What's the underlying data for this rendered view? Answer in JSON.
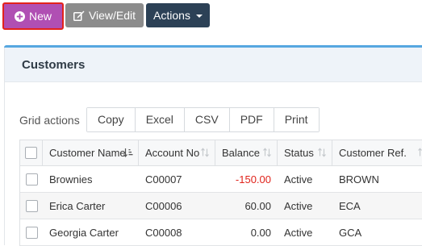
{
  "toolbar": {
    "new_label": "New",
    "view_edit_label": "View/Edit",
    "actions_label": "Actions"
  },
  "panel": {
    "title": "Customers"
  },
  "grid_actions": {
    "label": "Grid actions",
    "buttons": [
      "Copy",
      "Excel",
      "CSV",
      "PDF",
      "Print"
    ]
  },
  "table": {
    "columns": [
      "Customer Name",
      "Account No",
      "Balance",
      "Status",
      "Customer Ref."
    ],
    "rows": [
      {
        "name": "Brownies",
        "account": "C00007",
        "balance": "-150.00",
        "status": "Active",
        "ref": "BROWN"
      },
      {
        "name": "Erica Carter",
        "account": "C00006",
        "balance": "60.00",
        "status": "Active",
        "ref": "ECA"
      },
      {
        "name": "Georgia Carter",
        "account": "C00008",
        "balance": "0.00",
        "status": "Active",
        "ref": "GCA"
      }
    ]
  },
  "colors": {
    "new_button": "#b04fb3",
    "new_button_highlight": "#e3221b",
    "view_edit_button": "#8c8c8c",
    "actions_button": "#2c4156",
    "panel_accent": "#56a7e0",
    "negative_balance": "#e0231b"
  },
  "icons": {
    "new": "plus-circle-icon",
    "view_edit": "edit-icon",
    "actions": "caret-down-icon",
    "sort_active": "sort-alpha-asc-icon",
    "sort": "sort-icon"
  }
}
